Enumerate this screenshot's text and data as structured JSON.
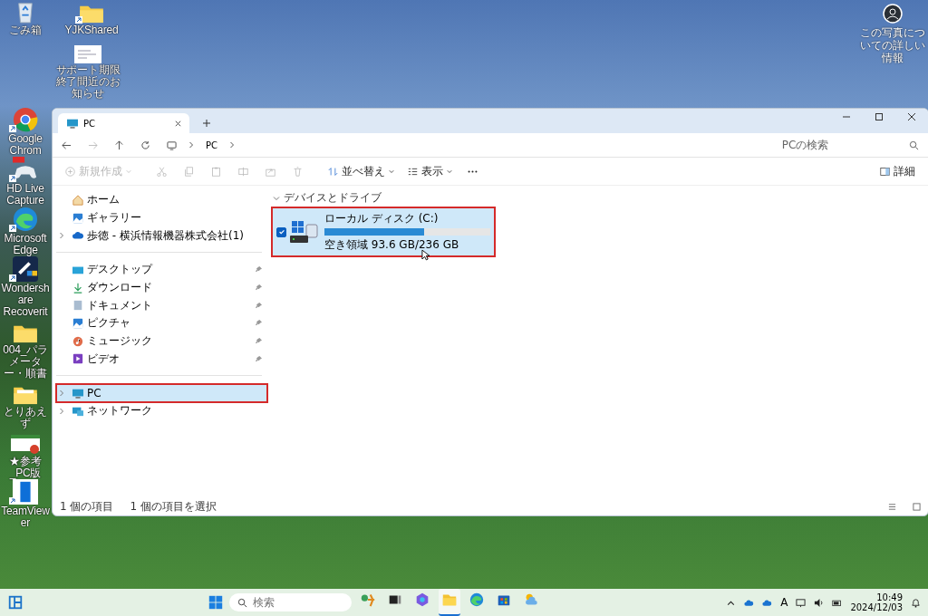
{
  "desktop_icons": [
    {
      "label": "ごみ箱",
      "kind": "recycle",
      "shortcut": false
    },
    {
      "label": "YJKShared",
      "kind": "folder",
      "shortcut": true
    },
    {
      "label": "サポート期限終了間近のお知らせ",
      "kind": "document",
      "shortcut": false
    },
    {
      "label": "Google Chrom",
      "kind": "chrome",
      "shortcut": true
    },
    {
      "label": "HD Live Capture",
      "kind": "capture",
      "shortcut": true
    },
    {
      "label": "Microsoft Edge",
      "kind": "edge",
      "shortcut": true
    },
    {
      "label": "Wondershare Recoverit",
      "kind": "recoverit",
      "shortcut": true
    },
    {
      "label": "004_パラメーター・順書",
      "kind": "folder",
      "shortcut": false
    },
    {
      "label": "とりあえず",
      "kind": "folder-doc",
      "shortcut": false
    },
    {
      "label": "★参考_PC版",
      "kind": "slide",
      "shortcut": false
    },
    {
      "label": "TeamViewer",
      "kind": "teamviewer",
      "shortcut": true
    }
  ],
  "photo_info": {
    "label": "この写真についての詳しい情報"
  },
  "window": {
    "tab": {
      "title": "PC"
    },
    "address": {
      "path": [
        "PC"
      ]
    },
    "search": {
      "placeholder": "PCの検索"
    },
    "toolbar": [
      {
        "kind": "new",
        "label": "新規作成",
        "disabled": true
      },
      {
        "kind": "cut",
        "disabled": true
      },
      {
        "kind": "copy",
        "disabled": true
      },
      {
        "kind": "paste",
        "disabled": true
      },
      {
        "kind": "rename",
        "disabled": true
      },
      {
        "kind": "share",
        "disabled": true
      },
      {
        "kind": "delete",
        "disabled": true
      },
      {
        "kind": "sort",
        "label": "並べ替え",
        "disabled": false
      },
      {
        "kind": "view",
        "label": "表示",
        "disabled": false
      },
      {
        "kind": "more",
        "disabled": false
      }
    ],
    "details_button": {
      "label": "詳細"
    },
    "sidebar": {
      "groups": [
        {
          "items": [
            {
              "label": "ホーム",
              "kind": "home",
              "expandable": false,
              "pinned": false,
              "selected": false,
              "highlighted": false
            },
            {
              "label": "ギャラリー",
              "kind": "gallery",
              "expandable": false,
              "pinned": false,
              "selected": false,
              "highlighted": false
            },
            {
              "label": "歩徳 - 横浜情報機器株式会社(1)",
              "kind": "cloud",
              "expandable": true,
              "pinned": false,
              "selected": false,
              "highlighted": false
            }
          ]
        },
        {
          "items": [
            {
              "label": "デスクトップ",
              "kind": "desktop",
              "expandable": false,
              "pinned": true,
              "selected": false,
              "highlighted": false
            },
            {
              "label": "ダウンロード",
              "kind": "download",
              "expandable": false,
              "pinned": true,
              "selected": false,
              "highlighted": false
            },
            {
              "label": "ドキュメント",
              "kind": "document",
              "expandable": false,
              "pinned": true,
              "selected": false,
              "highlighted": false
            },
            {
              "label": "ピクチャ",
              "kind": "gallery",
              "expandable": false,
              "pinned": true,
              "selected": false,
              "highlighted": false
            },
            {
              "label": "ミュージック",
              "kind": "music",
              "expandable": false,
              "pinned": true,
              "selected": false,
              "highlighted": false
            },
            {
              "label": "ビデオ",
              "kind": "video",
              "expandable": false,
              "pinned": true,
              "selected": false,
              "highlighted": false
            }
          ]
        },
        {
          "items": [
            {
              "label": "PC",
              "kind": "pc",
              "expandable": true,
              "pinned": false,
              "selected": true,
              "highlighted": true
            },
            {
              "label": "ネットワーク",
              "kind": "network",
              "expandable": true,
              "pinned": false,
              "selected": false,
              "highlighted": false
            }
          ]
        }
      ]
    },
    "section": {
      "title": "デバイスとドライブ",
      "expanded": true
    },
    "drives": [
      {
        "name": "ローカル ディスク (C:)",
        "level": 0.603,
        "free_text": "空き領域 93.6 GB/236 GB",
        "selected": true,
        "highlighted": true
      }
    ],
    "status_bar": {
      "item_count": "1 個の項目",
      "selection": "1 個の項目を選択"
    }
  },
  "taskbar": {
    "search_placeholder": "検索",
    "apps": [
      {
        "kind": "figure",
        "active": false
      },
      {
        "kind": "taskview",
        "active": false
      },
      {
        "kind": "copilot",
        "active": false
      },
      {
        "kind": "explorer",
        "active": true
      },
      {
        "kind": "edge",
        "active": false
      },
      {
        "kind": "store",
        "active": false
      },
      {
        "kind": "weather",
        "active": false
      }
    ],
    "ime": "A",
    "time": "10:49",
    "date": "2024/12/03"
  }
}
